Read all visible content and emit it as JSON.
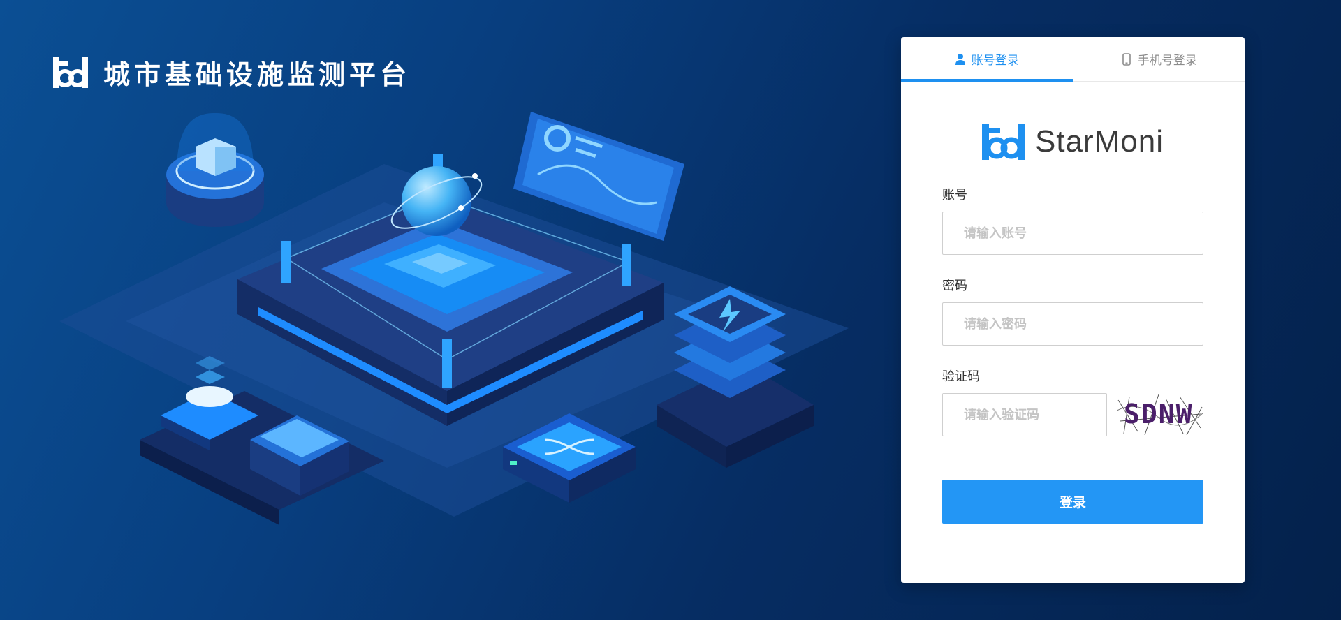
{
  "platform": {
    "title": "城市基础设施监测平台",
    "logo_icon": "bd-logo-icon"
  },
  "login_panel": {
    "tabs": [
      {
        "label": "账号登录",
        "icon": "user-icon",
        "active": true
      },
      {
        "label": "手机号登录",
        "icon": "mobile-phone-icon",
        "active": false
      }
    ],
    "brand_name": "StarMoni",
    "fields": {
      "account": {
        "label": "账号",
        "placeholder": "请输入账号",
        "value": ""
      },
      "password": {
        "label": "密码",
        "placeholder": "请输入密码",
        "value": ""
      },
      "captcha": {
        "label": "验证码",
        "placeholder": "请输入验证码",
        "value": "",
        "image_text": "SDNW"
      }
    },
    "submit_label": "登录"
  },
  "colors": {
    "accent": "#1e90f0",
    "button": "#2396f5",
    "background_light": "#0b4f94",
    "background_dark": "#04214b"
  }
}
